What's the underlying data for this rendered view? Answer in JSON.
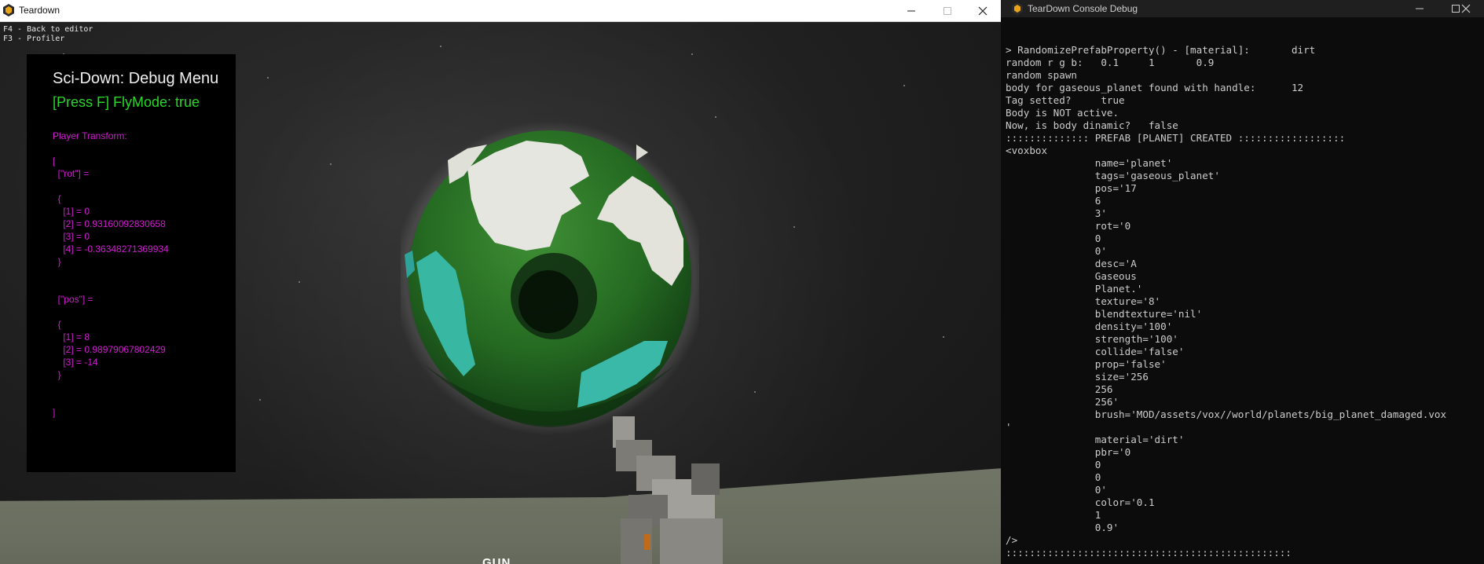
{
  "game_window": {
    "title": "Teardown",
    "hints": [
      "F4 - Back to editor",
      "F3 - Profiler"
    ],
    "debug_menu": {
      "title": "Sci-Down: Debug Menu",
      "fly_mode": "[Press F] FlyMode: true",
      "transform_lines": [
        "Player Transform:",
        "",
        "[",
        "  [\"rot\"] =",
        "",
        "  {",
        "    [1] = 0",
        "    [2] = 0.93160092830658",
        "    [3] = 0",
        "    [4] = -0.36348271369934",
        "  }",
        "",
        "",
        "  [\"pos\"] =",
        "",
        "  {",
        "    [1] = 8",
        "    [2] = 0.98979067802429",
        "    [3] = -14",
        "  }",
        "",
        "",
        "]"
      ]
    },
    "tool_label": "GUN"
  },
  "console_window": {
    "title": "TearDown Console Debug",
    "lines": [
      "> RandomizePrefabProperty() - [material]:       dirt",
      "random r g b:   0.1     1       0.9",
      "random spawn",
      "body for gaseous_planet found with handle:      12",
      "Tag setted?     true",
      "Body is NOT active.",
      "Now, is body dinamic?   false",
      ":::::::::::::: PREFAB [PLANET] CREATED ::::::::::::::::::",
      "<voxbox",
      "               name='planet'",
      "               tags='gaseous_planet'",
      "               pos='17",
      "               6",
      "               3'",
      "               rot='0",
      "               0",
      "               0'",
      "               desc='A",
      "               Gaseous",
      "               Planet.'",
      "               texture='8'",
      "               blendtexture='nil'",
      "               density='100'",
      "               strength='100'",
      "               collide='false'",
      "               prop='false'",
      "               size='256",
      "               256",
      "               256'",
      "               brush='MOD/assets/vox//world/planets/big_planet_damaged.vox",
      "'",
      "               material='dirt'",
      "               pbr='0",
      "               0",
      "               0",
      "               0'",
      "               color='0.1",
      "               1",
      "               0.9'",
      "/>",
      "::::::::::::::::::::::::::::::::::::::::::::::::"
    ]
  },
  "icons": {
    "app": "teardown-logo-icon",
    "minimize": "minimize-icon",
    "maximize": "maximize-icon",
    "close": "close-icon"
  },
  "colors": {
    "debug_title": "#f0f0f0",
    "fly_mode": "#27d627",
    "transform_text": "#d21dd2",
    "console_text": "#cccccc",
    "console_bg": "#0c0c0c",
    "planet_green": "#2f7f2a",
    "planet_cyan": "#38b7a3"
  }
}
